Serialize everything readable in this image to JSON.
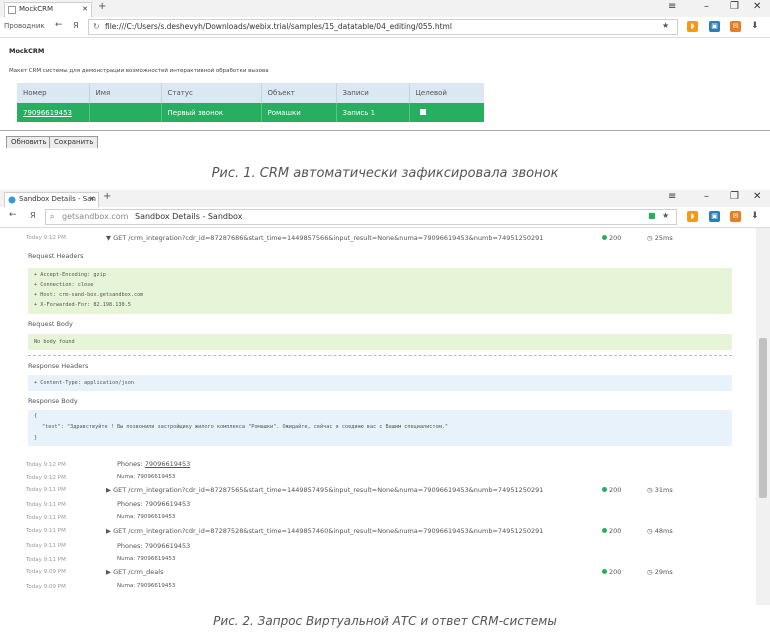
{
  "colors": {
    "accent": "#27ae60",
    "header": "#dbe7f3",
    "ok": "#27ae60"
  },
  "win1": {
    "tab_title": "MockCRM",
    "nav_label": "Проводник",
    "ya": "Я",
    "url": "file:///C:/Users/s.deshevyh/Downloads/webix.trial/samples/15_datatable/04_editing/055.html",
    "page_title": "MockCRM",
    "description": "Макет CRM системы для демонстрации возможностей интерактивной обработки вызова",
    "columns": [
      "Номер",
      "Имя",
      "Статус",
      "Объект",
      "Записи",
      "Целевой"
    ],
    "row": {
      "number": "79096619453",
      "name": "",
      "status": "Первый звонок",
      "object": "Ромашки",
      "records": "Запись 1"
    },
    "btn_refresh": "Обновить",
    "btn_save": "Сохранить"
  },
  "caption1": "Рис. 1. CRM автоматически зафиксировала звонок",
  "win2": {
    "tab_title": "Sandbox Details - San",
    "ya": "Я",
    "url_host": "getsandbox.com",
    "url_title": "Sandbox Details - Sandbox",
    "entry0": {
      "time": "Today 9:12 PM",
      "method": "▼ GET /crm_integration?cdr_id=87287686&start_time=1449857566&input_result=None&numa=79096619453&numb=74951250291",
      "status": "200",
      "duration": "25ms"
    },
    "request_headers_label": "Request Headers",
    "request_headers": [
      "+ Accept-Encoding: gzip",
      "+ Connection: close",
      "+ Host: crm-sand-box.getsandbox.com",
      "+ X-Forwarded-For: 82.198.130.5"
    ],
    "request_body_label": "Request Body",
    "request_body": "No body found",
    "response_headers_label": "Response Headers",
    "response_headers": [
      "+ Content-Type: application/json"
    ],
    "response_body_label": "Response Body",
    "response_body": [
      "{",
      "\"text\": \"Здравствуйте ! Вы позвонили  застройщику жилого комплекса \"Ромашки\". Ожидайте, сейчас я соединю вас с Вашим специалистом.\"",
      "}"
    ],
    "entries": [
      {
        "t1": "Today 9:12 PM",
        "phones": "Phones: 79096619453",
        "t2": "Today 9:12 PM",
        "numa": "Numa: 79096619453"
      },
      {
        "t1": "Today 9:11 PM",
        "method": "▶ GET /crm_integration?cdr_id=87287565&start_time=1449857495&input_result=None&numa=79096619453&numb=74951250291",
        "status": "200",
        "duration": "31ms"
      },
      {
        "t1": "Today 9:11 PM",
        "phones": "Phones: 79096619453",
        "t2": "Today 9:11 PM",
        "numa": "Numa: 79096619453"
      },
      {
        "t1": "Today 9:11 PM",
        "method": "▶ GET /crm_integration?cdr_id=87287528&start_time=1449857460&input_result=None&numa=79096619453&numb=74951250291",
        "status": "200",
        "duration": "48ms"
      },
      {
        "t1": "Today 9:11 PM",
        "phones": "Phones: 79096619453",
        "t2": "Today 9:11 PM",
        "numa": "Numa: 79096619453"
      },
      {
        "t1": "Today 9:09 PM",
        "method": "▶ GET /crm_deals",
        "status": "200",
        "duration": "29ms"
      },
      {
        "t1": "Today 9:09 PM",
        "numa": "Numa: 79096619453"
      }
    ]
  },
  "caption2": "Рис. 2. Запрос Виртуальной АТС и ответ CRM-системы"
}
